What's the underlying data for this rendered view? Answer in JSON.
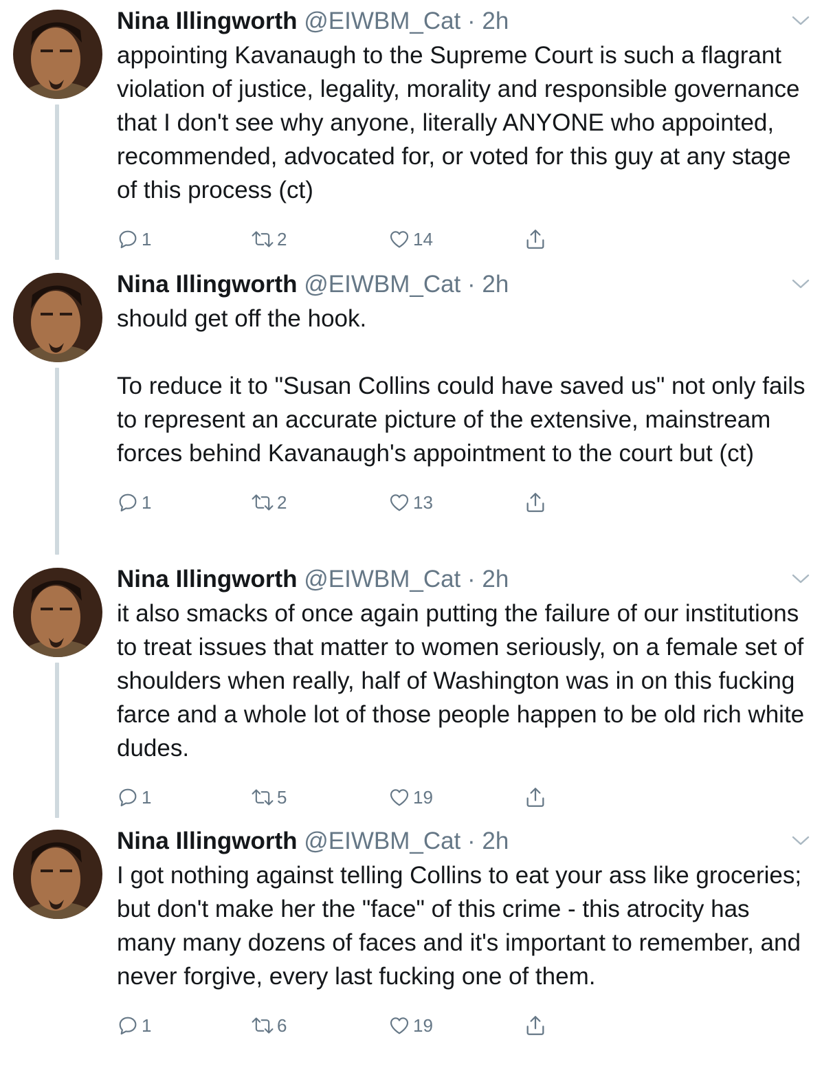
{
  "colors": {
    "name": "#14171a",
    "secondary": "#657786",
    "thread_line": "#cfd9de",
    "background": "#ffffff"
  },
  "icons": {
    "reply": "reply-icon",
    "retweet": "retweet-icon",
    "like": "heart-icon",
    "share": "share-icon",
    "menu": "chevron-down-icon"
  },
  "tweets": [
    {
      "name": "Nina Illingworth",
      "handle": "@EIWBM_Cat",
      "time": "· 2h",
      "text": "appointing Kavanaugh to the Supreme Court is such a flagrant violation of justice, legality, morality and responsible governance that I don't see why anyone, literally ANYONE who appointed, recommended, advocated for, or voted for this guy at any stage of this process (ct)",
      "replies": "1",
      "retweets": "2",
      "likes": "14"
    },
    {
      "name": "Nina Illingworth",
      "handle": "@EIWBM_Cat",
      "time": "· 2h",
      "text": "should get off the hook.\n\nTo reduce it to \"Susan Collins could have saved us\" not only fails to represent an accurate picture of the extensive, mainstream forces behind Kavanaugh's appointment to the court but (ct)",
      "replies": "1",
      "retweets": "2",
      "likes": "13"
    },
    {
      "name": "Nina Illingworth",
      "handle": "@EIWBM_Cat",
      "time": "· 2h",
      "text": "it also smacks of once again putting the failure of our institutions to treat issues that matter to women seriously, on a female set of shoulders when really, half of Washington was in on this fucking farce and a whole lot of those people happen to be old rich white dudes.",
      "replies": "1",
      "retweets": "5",
      "likes": "19"
    },
    {
      "name": "Nina Illingworth",
      "handle": "@EIWBM_Cat",
      "time": "· 2h",
      "text": "I got nothing against telling Collins to eat your ass like groceries; but don't make her the \"face\" of this crime - this atrocity has many many dozens of faces and it's important to remember, and never forgive, every last fucking one of them.",
      "replies": "1",
      "retweets": "6",
      "likes": "19"
    }
  ]
}
